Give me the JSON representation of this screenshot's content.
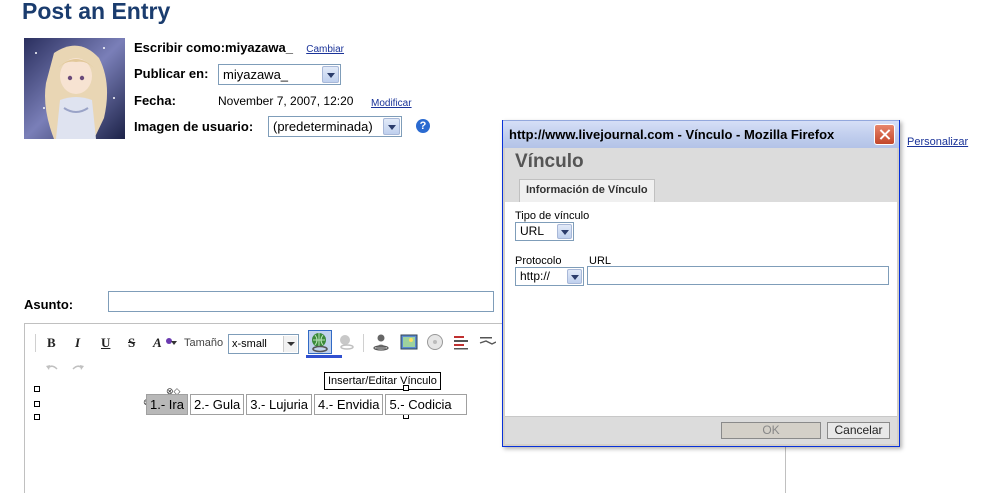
{
  "page": {
    "title": "Post an Entry"
  },
  "post_form": {
    "write_as_label": "Escribir como:",
    "write_as_user": "miyazawa_",
    "change_link": "Cambiar",
    "publish_in_label": "Publicar en:",
    "publish_in_value": "miyazawa_",
    "date_label": "Fecha:",
    "date_value": "November 7, 2007, 12:20",
    "modify_link": "Modificar",
    "userpic_label": "Imagen de usuario:",
    "userpic_value": "(predeterminada)",
    "help_icon": "?",
    "customize_link": "Personalizar",
    "subject_label": "Asunto:",
    "subject_value": ""
  },
  "editor": {
    "bold": "B",
    "italic": "I",
    "underline": "U",
    "strike": "S",
    "font_color": "A",
    "size_label": "Tamaño",
    "size_value": "x-small",
    "tooltip": "Insertar/Editar Vínculo",
    "table_cells": [
      "1.- Ira",
      "2.- Gula",
      "3.- Lujuria",
      "4.- Envidia",
      "5.- Codicia"
    ]
  },
  "dialog": {
    "window_title": "http://www.livejournal.com - Vínculo - Mozilla Firefox",
    "heading": "Vínculo",
    "tab": "Información de Vínculo",
    "link_type_label": "Tipo de vínculo",
    "link_type_value": "URL",
    "protocol_label": "Protocolo",
    "protocol_value": "http://",
    "url_label": "URL",
    "url_value": "",
    "ok_button": "OK",
    "cancel_button": "Cancelar"
  }
}
